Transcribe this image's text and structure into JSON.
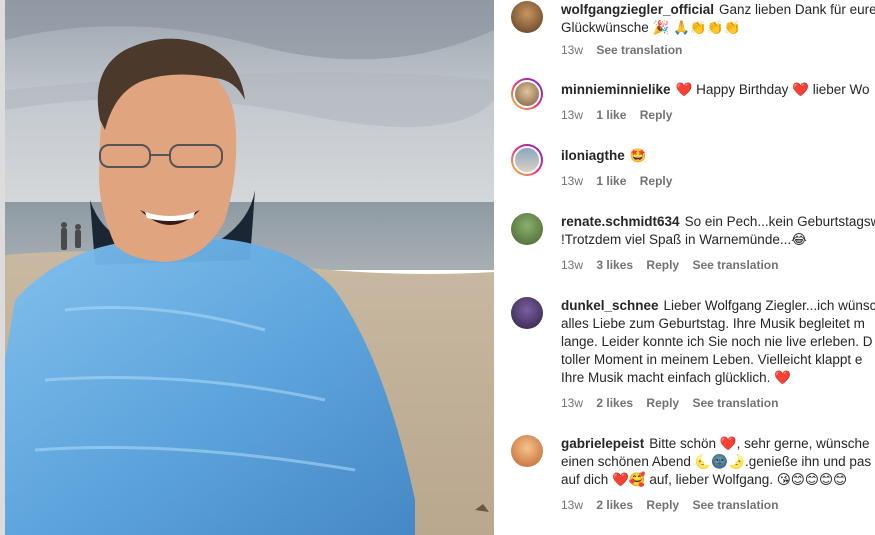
{
  "comments": [
    {
      "user": "wolfgangziegler_official",
      "lines": [
        "Ganz lieben Dank für eure",
        "Glückwünsche 🎉 🙏👏👏👏"
      ],
      "time": "13w",
      "likes": "",
      "reply": "",
      "translate": "See translation"
    },
    {
      "user": "minnieminnielike",
      "lines": [
        "❤️ Happy Birthday ❤️ lieber Wo"
      ],
      "time": "13w",
      "likes": "1 like",
      "reply": "Reply",
      "translate": ""
    },
    {
      "user": "iloniagthe",
      "lines": [
        "🤩"
      ],
      "time": "13w",
      "likes": "1 like",
      "reply": "Reply",
      "translate": ""
    },
    {
      "user": "renate.schmidt634",
      "lines": [
        "So ein Pech...kein Geburtstagsw",
        "!Trotzdem viel Spaß in Warnemünde...😂"
      ],
      "time": "13w",
      "likes": "3 likes",
      "reply": "Reply",
      "translate": "See translation"
    },
    {
      "user": "dunkel_schnee",
      "lines": [
        "Lieber Wolfgang Ziegler...ich wünsc",
        "alles Liebe zum Geburtstag. Ihre Musik begleitet m",
        "lange. Leider konnte ich Sie noch nie live erleben. D",
        "toller Moment in meinem Leben. Vielleicht klappt e",
        "Ihre Musik macht einfach glücklich. ❤️"
      ],
      "time": "13w",
      "likes": "2 likes",
      "reply": "Reply",
      "translate": "See translation"
    },
    {
      "user": "gabrielepeist",
      "lines": [
        "Bitte schön ❤️, sehr gerne, wünsche",
        "einen schönen Abend 🌜🌚🌛.genieße ihn und pas",
        "auf dich ❤️🥰 auf, lieber Wolfgang. 😘😊😊😊😊"
      ],
      "time": "13w",
      "likes": "2 likes",
      "reply": "Reply",
      "translate": "See translation"
    }
  ]
}
